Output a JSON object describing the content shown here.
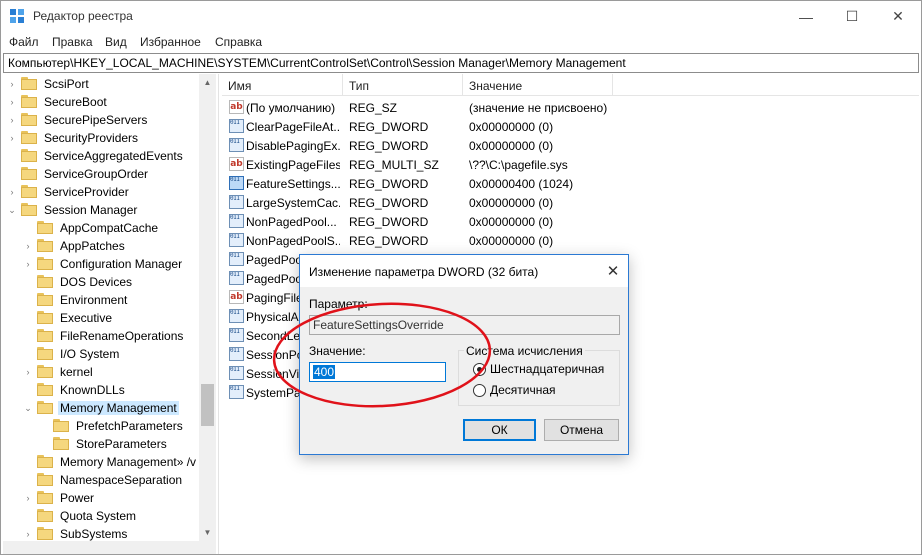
{
  "window": {
    "title": "Редактор реестра",
    "controls": {
      "minimize": "—",
      "maximize": "☐",
      "close": "✕"
    }
  },
  "menu": [
    "Файл",
    "Правка",
    "Вид",
    "Избранное",
    "Справка"
  ],
  "address": "Компьютер\\HKEY_LOCAL_MACHINE\\SYSTEM\\CurrentControlSet\\Control\\Session Manager\\Memory Management",
  "tree": [
    {
      "label": "ScsiPort",
      "depth": 0,
      "expander": "›"
    },
    {
      "label": "SecureBoot",
      "depth": 0,
      "expander": "›"
    },
    {
      "label": "SecurePipeServers",
      "depth": 0,
      "expander": "›"
    },
    {
      "label": "SecurityProviders",
      "depth": 0,
      "expander": "›"
    },
    {
      "label": "ServiceAggregatedEvents",
      "depth": 0,
      "expander": ""
    },
    {
      "label": "ServiceGroupOrder",
      "depth": 0,
      "expander": ""
    },
    {
      "label": "ServiceProvider",
      "depth": 0,
      "expander": "›"
    },
    {
      "label": "Session Manager",
      "depth": 0,
      "expander": "⌄"
    },
    {
      "label": "AppCompatCache",
      "depth": 1,
      "expander": ""
    },
    {
      "label": "AppPatches",
      "depth": 1,
      "expander": "›"
    },
    {
      "label": "Configuration Manager",
      "depth": 1,
      "expander": "›"
    },
    {
      "label": "DOS Devices",
      "depth": 1,
      "expander": ""
    },
    {
      "label": "Environment",
      "depth": 1,
      "expander": ""
    },
    {
      "label": "Executive",
      "depth": 1,
      "expander": ""
    },
    {
      "label": "FileRenameOperations",
      "depth": 1,
      "expander": ""
    },
    {
      "label": "I/O System",
      "depth": 1,
      "expander": ""
    },
    {
      "label": "kernel",
      "depth": 1,
      "expander": "›"
    },
    {
      "label": "KnownDLLs",
      "depth": 1,
      "expander": ""
    },
    {
      "label": "Memory Management",
      "depth": 1,
      "expander": "⌄",
      "selected": true
    },
    {
      "label": "PrefetchParameters",
      "depth": 2,
      "expander": ""
    },
    {
      "label": "StoreParameters",
      "depth": 2,
      "expander": ""
    },
    {
      "label": "Memory Management» /v",
      "depth": 1,
      "expander": ""
    },
    {
      "label": "NamespaceSeparation",
      "depth": 1,
      "expander": ""
    },
    {
      "label": "Power",
      "depth": 1,
      "expander": "›"
    },
    {
      "label": "Quota System",
      "depth": 1,
      "expander": ""
    },
    {
      "label": "SubSystems",
      "depth": 1,
      "expander": "›"
    }
  ],
  "list": {
    "columns": [
      "Имя",
      "Тип",
      "Значение"
    ],
    "rows": [
      {
        "icon": "string-value-icon",
        "name": "(По умолчанию)",
        "type": "REG_SZ",
        "value": "(значение не присвоено)"
      },
      {
        "icon": "binary-value-icon",
        "name": "ClearPageFileAt...",
        "type": "REG_DWORD",
        "value": "0x00000000 (0)"
      },
      {
        "icon": "binary-value-icon",
        "name": "DisablePagingEx...",
        "type": "REG_DWORD",
        "value": "0x00000000 (0)"
      },
      {
        "icon": "string-value-icon",
        "name": "ExistingPageFiles",
        "type": "REG_MULTI_SZ",
        "value": "\\??\\C:\\pagefile.sys"
      },
      {
        "icon": "binary-value-icon",
        "name": "FeatureSettings...",
        "type": "REG_DWORD",
        "value": "0x00000400 (1024)",
        "selected": true
      },
      {
        "icon": "binary-value-icon",
        "name": "LargeSystemCac...",
        "type": "REG_DWORD",
        "value": "0x00000000 (0)"
      },
      {
        "icon": "binary-value-icon",
        "name": "NonPagedPool...",
        "type": "REG_DWORD",
        "value": "0x00000000 (0)"
      },
      {
        "icon": "binary-value-icon",
        "name": "NonPagedPoolS...",
        "type": "REG_DWORD",
        "value": "0x00000000 (0)"
      },
      {
        "icon": "binary-value-icon",
        "name": "PagedPoo",
        "type": "",
        "value": ""
      },
      {
        "icon": "binary-value-icon",
        "name": "PagedPoo",
        "type": "",
        "value": ""
      },
      {
        "icon": "string-value-icon",
        "name": "PagingFile",
        "type": "",
        "value": ""
      },
      {
        "icon": "binary-value-icon",
        "name": "PhysicalA",
        "type": "",
        "value": ""
      },
      {
        "icon": "binary-value-icon",
        "name": "SecondLev",
        "type": "",
        "value": ""
      },
      {
        "icon": "binary-value-icon",
        "name": "SessionPo",
        "type": "",
        "value": ""
      },
      {
        "icon": "binary-value-icon",
        "name": "SessionVie",
        "type": "",
        "value": ""
      },
      {
        "icon": "binary-value-icon",
        "name": "SystemPa",
        "type": "",
        "value": ""
      }
    ]
  },
  "dialog": {
    "title": "Изменение параметра DWORD (32 бита)",
    "close": "✕",
    "param_label": "Параметр:",
    "param_value": "FeatureSettingsOverride",
    "value_label": "Значение:",
    "value": "400",
    "base_group": "Система исчисления",
    "radio_hex": "Шестнадцатеричная",
    "radio_dec": "Десятичная",
    "selected_base": "hex",
    "ok": "ОК",
    "cancel": "Отмена"
  },
  "colors": {
    "selection": "#cce8ff",
    "accent": "#0078d7",
    "annotation": "#e0121a"
  }
}
